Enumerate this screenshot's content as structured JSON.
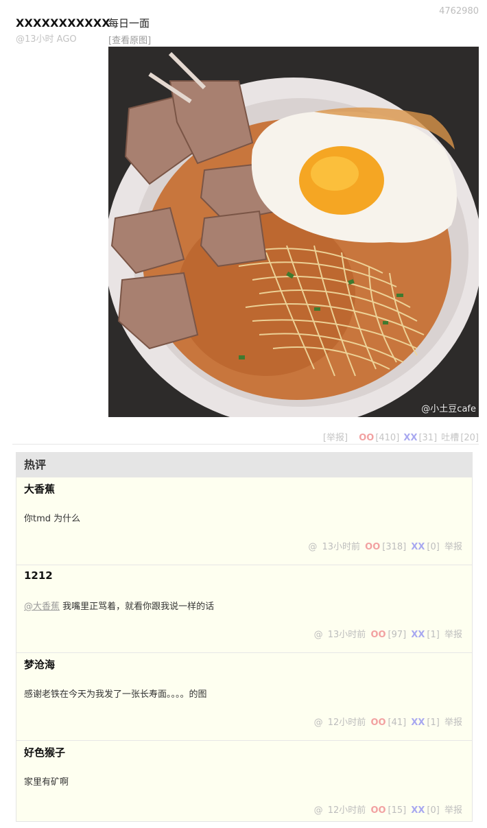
{
  "post": {
    "id": "4762980",
    "author": "XXXXXXXXXXX",
    "time": "@13小时 AGO",
    "title": "每日一面",
    "view_original": "[查看原图]",
    "image_watermark": "@小土豆cafe",
    "actions": {
      "report": "[举报]",
      "oo_label": "OO",
      "oo_count": "[410]",
      "xx_label": "XX",
      "xx_count": "[31]",
      "tucao_label": "吐槽",
      "tucao_count": "[20]"
    }
  },
  "comments_section": {
    "title": "热评",
    "items": [
      {
        "author": "大香蕉",
        "mention": "",
        "text": "你tmd 为什么",
        "at": "@",
        "time": "13小时前",
        "oo_label": "OO",
        "oo_count": "[318]",
        "xx_label": "XX",
        "xx_count": "[0]",
        "report": "举报"
      },
      {
        "author": "1212",
        "mention": "@大香蕉",
        "text": " 我嘴里正骂着，就看你跟我说一样的话",
        "at": "@",
        "time": "13小时前",
        "oo_label": "OO",
        "oo_count": "[97]",
        "xx_label": "XX",
        "xx_count": "[1]",
        "report": "举报"
      },
      {
        "author": "梦沧海",
        "mention": "",
        "text": "感谢老铁在今天为我发了一张长寿面。。。。的图",
        "at": "@",
        "time": "12小时前",
        "oo_label": "OO",
        "oo_count": "[41]",
        "xx_label": "XX",
        "xx_count": "[1]",
        "report": "举报"
      },
      {
        "author": "好色猴子",
        "mention": "",
        "text": "家里有矿啊",
        "at": "@",
        "time": "12小时前",
        "oo_label": "OO",
        "oo_count": "[15]",
        "xx_label": "XX",
        "xx_count": "[0]",
        "report": "举报"
      }
    ]
  },
  "colors": {
    "oo": "#f2a1a1",
    "xx": "#a8a8f0",
    "comment_bg": "#fefff0",
    "header_bg": "#e5e5e5"
  }
}
